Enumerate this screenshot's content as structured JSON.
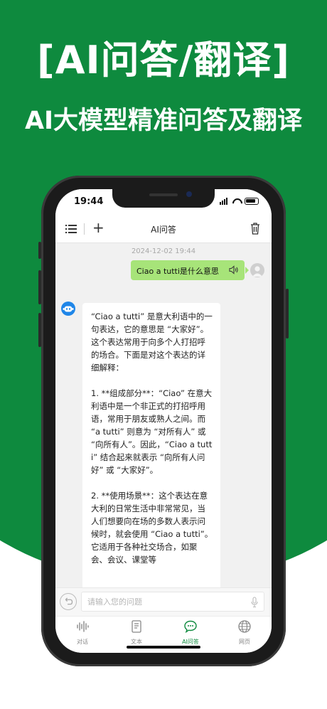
{
  "promo": {
    "headline": "[AI问答/翻译]",
    "subline": "AI大模型精准问答及翻译",
    "colors": {
      "brand_green": "#0e8a3e",
      "user_bubble": "#a7e479"
    }
  },
  "status_bar": {
    "time": "19:44"
  },
  "nav": {
    "title": "AI问答",
    "plus_glyph": "+"
  },
  "chat": {
    "timestamp": "2024-12-02 19:44",
    "user_message": "Ciao a tutti是什么意思",
    "bot_paragraphs": [
      "“Ciao a tutti” 是意大利语中的一句表达，它的意思是 “大家好”。这个表达常用于向多个人打招呼的场合。下面是对这个表达的详细解释：",
      "1. **组成部分**：“Ciao” 在意大利语中是一个非正式的打招呼用语，常用于朋友或熟人之间。而 “a tutti” 则意为 “对所有人” 或 “向所有人”。因此，“Ciao a tutti” 结合起来就表示 “向所有人问好” 或 “大家好”。",
      "2. **使用场景**：这个表达在意大利的日常生活中非常常见，当人们想要向在场的多数人表示问候时，就会使用 “Ciao a tutti”。它适用于各种社交场合，如聚会、会议、课堂等"
    ]
  },
  "input": {
    "placeholder": "请输入您的问题",
    "value": ""
  },
  "tabs": [
    {
      "label": "对话",
      "icon": "waveform-icon",
      "active": false
    },
    {
      "label": "文本",
      "icon": "document-icon",
      "active": false
    },
    {
      "label": "AI问答",
      "icon": "chat-bubble-icon",
      "active": true
    },
    {
      "label": "网页",
      "icon": "globe-icon",
      "active": false
    }
  ]
}
